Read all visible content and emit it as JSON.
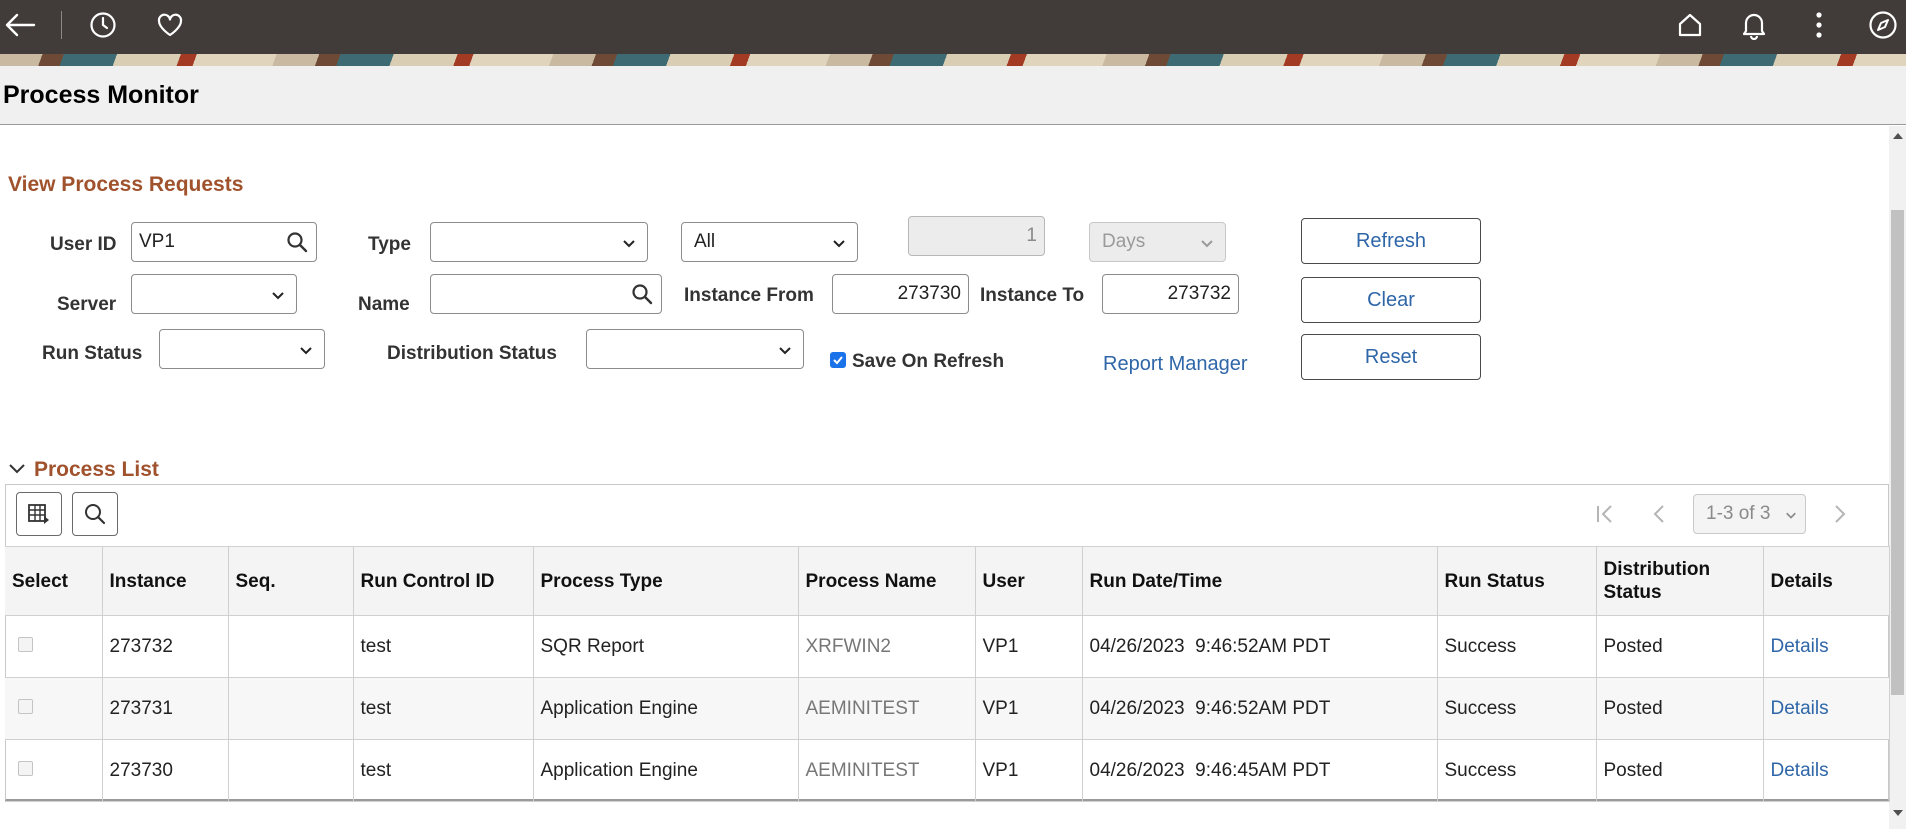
{
  "page": {
    "title": "Process Monitor"
  },
  "criteria": {
    "section_title": "View Process Requests",
    "user_id_label": "User ID",
    "user_id_value": "VP1",
    "type_label": "Type",
    "type_value": "",
    "range_value": "All",
    "period_value": "1",
    "period_unit": "Days",
    "server_label": "Server",
    "server_value": "",
    "name_label": "Name",
    "name_value": "",
    "instance_from_label": "Instance From",
    "instance_from_value": "273730",
    "instance_to_label": "Instance To",
    "instance_to_value": "273732",
    "run_status_label": "Run Status",
    "run_status_value": "",
    "dist_status_label": "Distribution Status",
    "dist_status_value": "",
    "save_on_refresh_label": "Save On Refresh",
    "save_on_refresh_checked": true,
    "report_manager_link": "Report Manager",
    "refresh_button": "Refresh",
    "clear_button": "Clear",
    "reset_button": "Reset"
  },
  "process_list": {
    "section_title": "Process List",
    "pager": "1-3 of 3",
    "columns": [
      "Select",
      "Instance",
      "Seq.",
      "Run Control ID",
      "Process Type",
      "Process Name",
      "User",
      "Run Date/Time",
      "Run Status",
      "Distribution Status",
      "Details"
    ],
    "rows": [
      {
        "instance": "273732",
        "seq": "",
        "run_control": "test",
        "process_type": "SQR Report",
        "process_name": "XRFWIN2",
        "user": "VP1",
        "run_datetime": "04/26/2023  9:46:52AM PDT",
        "run_status": "Success",
        "dist_status": "Posted",
        "details": "Details"
      },
      {
        "instance": "273731",
        "seq": "",
        "run_control": "test",
        "process_type": "Application Engine",
        "process_name": "AEMINITEST",
        "user": "VP1",
        "run_datetime": "04/26/2023  9:46:52AM PDT",
        "run_status": "Success",
        "dist_status": "Posted",
        "details": "Details"
      },
      {
        "instance": "273730",
        "seq": "",
        "run_control": "test",
        "process_type": "Application Engine",
        "process_name": "AEMINITEST",
        "user": "VP1",
        "run_datetime": "04/26/2023  9:46:45AM PDT",
        "run_status": "Success",
        "dist_status": "Posted",
        "details": "Details"
      }
    ]
  },
  "colors": {
    "topbar": "#413c39",
    "section_title": "#a0522d",
    "link": "#2e66a8"
  }
}
